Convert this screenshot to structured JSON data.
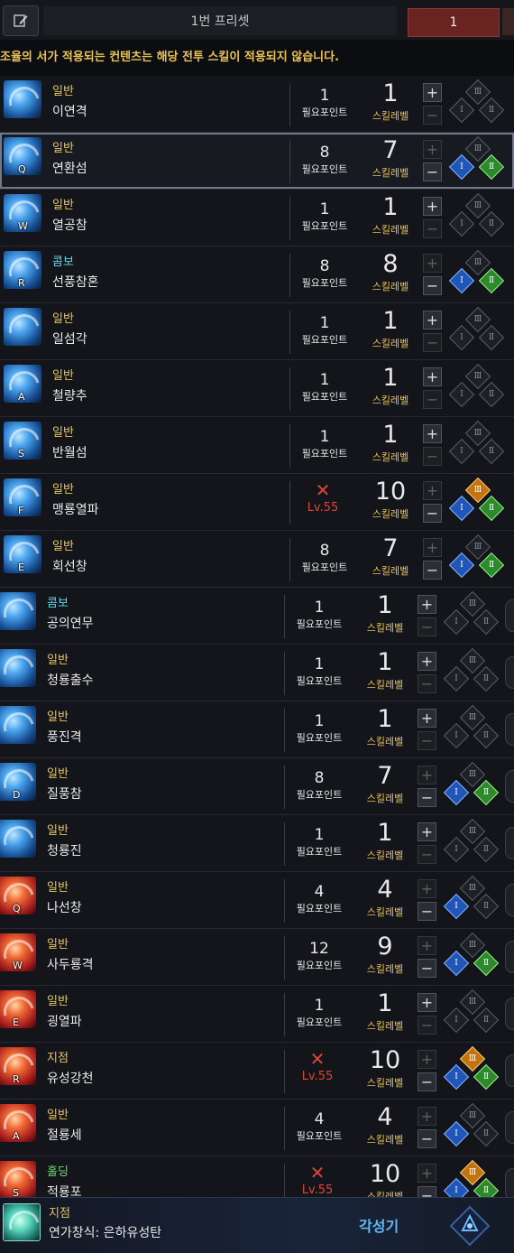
{
  "header": {
    "edit_icon": "pencil-edit-icon",
    "preset_name": "1번 프리셋",
    "preset_number": "1"
  },
  "notice": "조율의 서가 적용되는 컨텐츠는 해당 전투 스킬이 적용되지 않습니다.",
  "labels": {
    "required_points": "필요포인트",
    "skill_level": "스킬레벨",
    "plus": "+",
    "minus": "−"
  },
  "skills": [
    {
      "category": "일반",
      "name": "이연격",
      "hotkey": "",
      "req": "1",
      "locked": false,
      "level": "1",
      "tripods": []
    },
    {
      "category": "일반",
      "name": "연환섬",
      "hotkey": "Q",
      "req": "8",
      "locked": false,
      "level": "7",
      "tripods": [
        "I",
        "II"
      ]
    },
    {
      "category": "일반",
      "name": "열공참",
      "hotkey": "W",
      "req": "1",
      "locked": false,
      "level": "1",
      "tripods": []
    },
    {
      "category": "콤보",
      "name": "선풍참혼",
      "hotkey": "R",
      "req": "8",
      "locked": false,
      "level": "8",
      "tripods": [
        "I",
        "II"
      ]
    },
    {
      "category": "일반",
      "name": "일섬각",
      "hotkey": "",
      "req": "1",
      "locked": false,
      "level": "1",
      "tripods": []
    },
    {
      "category": "일반",
      "name": "철량추",
      "hotkey": "A",
      "req": "1",
      "locked": false,
      "level": "1",
      "tripods": []
    },
    {
      "category": "일반",
      "name": "반월섬",
      "hotkey": "S",
      "req": "1",
      "locked": false,
      "level": "1",
      "tripods": []
    },
    {
      "category": "일반",
      "name": "맹룡열파",
      "hotkey": "F",
      "req": "",
      "locked": true,
      "lock_level": "Lv.55",
      "level": "10",
      "tripods": [
        "I",
        "II",
        "III"
      ]
    },
    {
      "category": "일반",
      "name": "회선창",
      "hotkey": "E",
      "req": "8",
      "locked": false,
      "level": "7",
      "tripods": [
        "I",
        "II"
      ]
    },
    {
      "category": "콤보",
      "name": "공의연무",
      "hotkey": "",
      "req": "1",
      "locked": false,
      "level": "1",
      "tripods": []
    },
    {
      "category": "일반",
      "name": "청룡출수",
      "hotkey": "",
      "req": "1",
      "locked": false,
      "level": "1",
      "tripods": []
    },
    {
      "category": "일반",
      "name": "풍진격",
      "hotkey": "",
      "req": "1",
      "locked": false,
      "level": "1",
      "tripods": []
    },
    {
      "category": "일반",
      "name": "질풍참",
      "hotkey": "D",
      "req": "8",
      "locked": false,
      "level": "7",
      "tripods": [
        "I",
        "II"
      ]
    },
    {
      "category": "일반",
      "name": "청룡진",
      "hotkey": "",
      "req": "1",
      "locked": false,
      "level": "1",
      "tripods": []
    },
    {
      "category": "일반",
      "name": "나선창",
      "hotkey": "Q",
      "req": "4",
      "locked": false,
      "level": "4",
      "tripods": [
        "I"
      ]
    },
    {
      "category": "일반",
      "name": "사두룡격",
      "hotkey": "W",
      "req": "12",
      "locked": false,
      "level": "9",
      "tripods": [
        "I",
        "II"
      ]
    },
    {
      "category": "일반",
      "name": "굉열파",
      "hotkey": "E",
      "req": "1",
      "locked": false,
      "level": "1",
      "tripods": []
    },
    {
      "category": "지점",
      "name": "유성강천",
      "hotkey": "R",
      "req": "",
      "locked": true,
      "lock_level": "Lv.55",
      "level": "10",
      "tripods": [
        "I",
        "II",
        "III"
      ]
    },
    {
      "category": "일반",
      "name": "절룡세",
      "hotkey": "A",
      "req": "4",
      "locked": false,
      "level": "4",
      "tripods": [
        "I"
      ]
    },
    {
      "category": "홀딩",
      "name": "적룡포",
      "hotkey": "S",
      "req": "",
      "locked": true,
      "lock_level": "Lv.55",
      "level": "10",
      "tripods": [
        "I",
        "II",
        "III"
      ]
    }
  ],
  "awakening": {
    "category": "지점",
    "name": "연가창식: 은하유성탄",
    "label": "각성기"
  },
  "colors": {
    "gold": "#e9c35a",
    "combo": "#5fd6e6",
    "hold": "#6fdb6a",
    "locked_red": "#d8473a",
    "tripod_blue": "#1f56b8",
    "tripod_green": "#2c8a2c",
    "tripod_orange": "#c27314"
  }
}
